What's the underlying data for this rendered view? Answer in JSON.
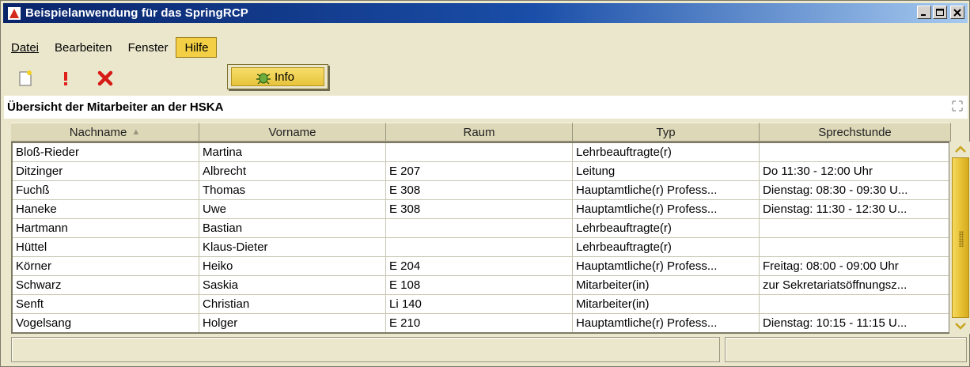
{
  "window": {
    "title": "Beispielanwendung für das SpringRCP",
    "app_icon": "springrcp-icon",
    "buttons": [
      "minimize-icon",
      "maximize-icon",
      "close-icon"
    ]
  },
  "menubar": {
    "items": [
      {
        "label": "Datei"
      },
      {
        "label": "Bearbeiten"
      },
      {
        "label": "Fenster"
      },
      {
        "label": "Hilfe",
        "active": true
      }
    ]
  },
  "help_menu": {
    "items": [
      {
        "label": "Info",
        "icon": "bug-icon"
      }
    ]
  },
  "toolbar": {
    "items": [
      "new-document-icon",
      "exclamation-icon",
      "delete-icon"
    ]
  },
  "panel": {
    "title": "Übersicht der Mitarbeiter an der HSKA"
  },
  "table": {
    "columns": [
      {
        "label": "Nachname",
        "sorted": "ascending"
      },
      {
        "label": "Vorname"
      },
      {
        "label": "Raum"
      },
      {
        "label": "Typ"
      },
      {
        "label": "Sprechstunde"
      }
    ],
    "rows": [
      [
        "Bloß-Rieder",
        "Martina",
        "",
        "Lehrbeauftragte(r)",
        ""
      ],
      [
        "Ditzinger",
        "Albrecht",
        "E 207",
        "Leitung",
        "Do 11:30 - 12:00 Uhr"
      ],
      [
        "Fuchß",
        "Thomas",
        "E 308",
        "Hauptamtliche(r) Profess...",
        "Dienstag: 08:30 - 09:30 U..."
      ],
      [
        "Haneke",
        "Uwe",
        "E 308",
        "Hauptamtliche(r) Profess...",
        "Dienstag: 11:30 - 12:30 U..."
      ],
      [
        "Hartmann",
        "Bastian",
        "",
        "Lehrbeauftragte(r)",
        ""
      ],
      [
        "Hüttel",
        "Klaus-Dieter",
        "",
        "Lehrbeauftragte(r)",
        ""
      ],
      [
        "Körner",
        "Heiko",
        "E 204",
        "Hauptamtliche(r) Profess...",
        "Freitag: 08:00 - 09:00 Uhr"
      ],
      [
        "Schwarz",
        "Saskia",
        "E 108",
        "Mitarbeiter(in)",
        "zur Sekretariatsöffnungsz..."
      ],
      [
        "Senft",
        "Christian",
        "Li 140",
        "Mitarbeiter(in)",
        ""
      ],
      [
        "Vogelsang",
        "Holger",
        "E 210",
        "Hauptamtliche(r) Profess...",
        "Dienstag: 10:15 - 11:15 U..."
      ]
    ]
  },
  "colors": {
    "accent": "#e8c235",
    "title_bar": "#0a246a",
    "background": "#ebe7cd"
  }
}
